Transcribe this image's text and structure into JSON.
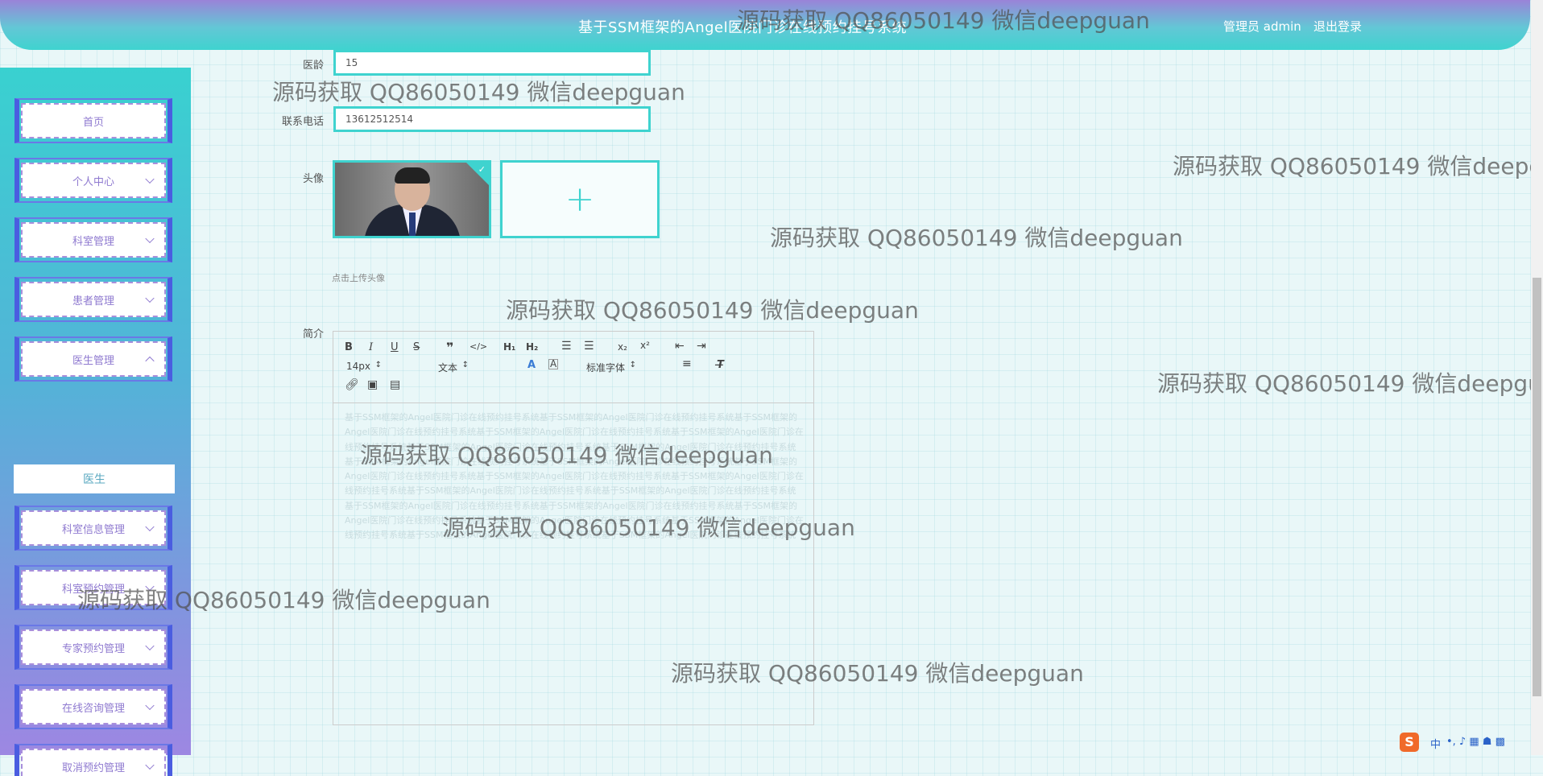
{
  "header": {
    "title": "基于SSM框架的Angel医院门诊在线预约挂号系统",
    "user": "管理员 admin",
    "logout": "退出登录"
  },
  "sidebar": {
    "items": [
      {
        "label": "首页",
        "chevron": "none"
      },
      {
        "label": "个人中心",
        "chevron": "down"
      },
      {
        "label": "科室管理",
        "chevron": "down"
      },
      {
        "label": "患者管理",
        "chevron": "down"
      },
      {
        "label": "医生管理",
        "chevron": "up"
      },
      {
        "label": "科室信息管理",
        "chevron": "down"
      },
      {
        "label": "科室预约管理",
        "chevron": "down"
      },
      {
        "label": "专家预约管理",
        "chevron": "down"
      },
      {
        "label": "在线咨询管理",
        "chevron": "down"
      },
      {
        "label": "取消预约管理",
        "chevron": "down"
      }
    ],
    "active_sub": "医生"
  },
  "form": {
    "age_label": "医龄",
    "age_value": "15",
    "phone_label": "联系电话",
    "phone_value": "13612512514",
    "avatar_label": "头像",
    "upload_tip": "点击上传头像",
    "intro_label": "简介"
  },
  "editor": {
    "font_size": "14px",
    "heading": "文本",
    "font_family": "标准字体",
    "content": "基于SSM框架的Angel医院门诊在线预约挂号系统基于SSM框架的Angel医院门诊在线预约挂号系统基于SSM框架的Angel医院门诊在线预约挂号系统基于SSM框架的Angel医院门诊在线预约挂号系统基于SSM框架的Angel医院门诊在线预约挂号系统基于SSM框架的Angel医院门诊在线预约挂号系统基于SSM框架的Angel医院门诊在线预约挂号系统基于SSM框架的Angel医院门诊在线预约挂号系统基于SSM框架的Angel医院门诊在线预约挂号系统基于SSM框架的Angel医院门诊在线预约挂号系统基于SSM框架的Angel医院门诊在线预约挂号系统基于SSM框架的Angel医院门诊在线预约挂号系统基于SSM框架的Angel医院门诊在线预约挂号系统基于SSM框架的Angel医院门诊在线预约挂号系统基于SSM框架的Angel医院门诊在线预约挂号系统基于SSM框架的Angel医院门诊在线预约挂号系统基于SSM框架的Angel医院门诊在线预约挂号系统基于SSM框架的Angel医院门诊在线预约挂号系统基于SSM框架的Angel医院门诊在线预约挂号系统基于SSM框架的Angel医院门诊在线预约挂号系统基于SSM框架的Angel医院门诊在线预约挂号系统"
  },
  "watermark": "源码获取 QQ86050149 微信deepguan",
  "ime": "中"
}
